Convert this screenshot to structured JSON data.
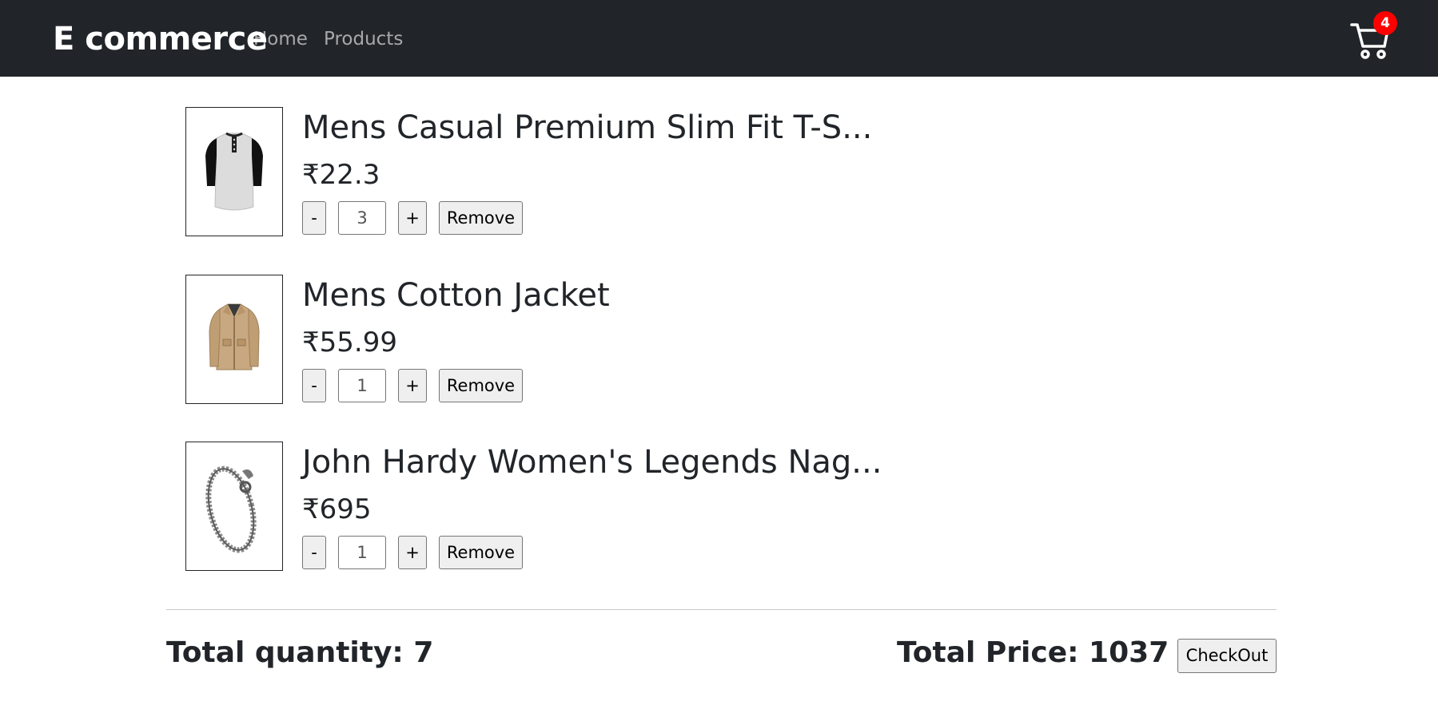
{
  "navbar": {
    "brand": "E commerce",
    "links": [
      "Home",
      "Products"
    ],
    "cart_icon": "shopping-cart-icon",
    "cart_count": "4",
    "badge_color": "#ff0000",
    "background": "#212529"
  },
  "cart": {
    "items": [
      {
        "title": "Mens Casual Premium Slim Fit T-S...",
        "price": "₹22.3",
        "quantity": "3",
        "image": "tshirt-image",
        "minus_label": "-",
        "plus_label": "+",
        "remove_label": "Remove"
      },
      {
        "title": "Mens Cotton Jacket",
        "price": "₹55.99",
        "quantity": "1",
        "image": "jacket-image",
        "minus_label": "-",
        "plus_label": "+",
        "remove_label": "Remove"
      },
      {
        "title": "John Hardy Women's Legends Nag...",
        "price": "₹695",
        "quantity": "1",
        "image": "bracelet-image",
        "minus_label": "-",
        "plus_label": "+",
        "remove_label": "Remove"
      }
    ]
  },
  "summary": {
    "total_quantity": "Total quantity: 7",
    "total_price": "Total Price: 1037",
    "checkout_label": "CheckOut"
  }
}
